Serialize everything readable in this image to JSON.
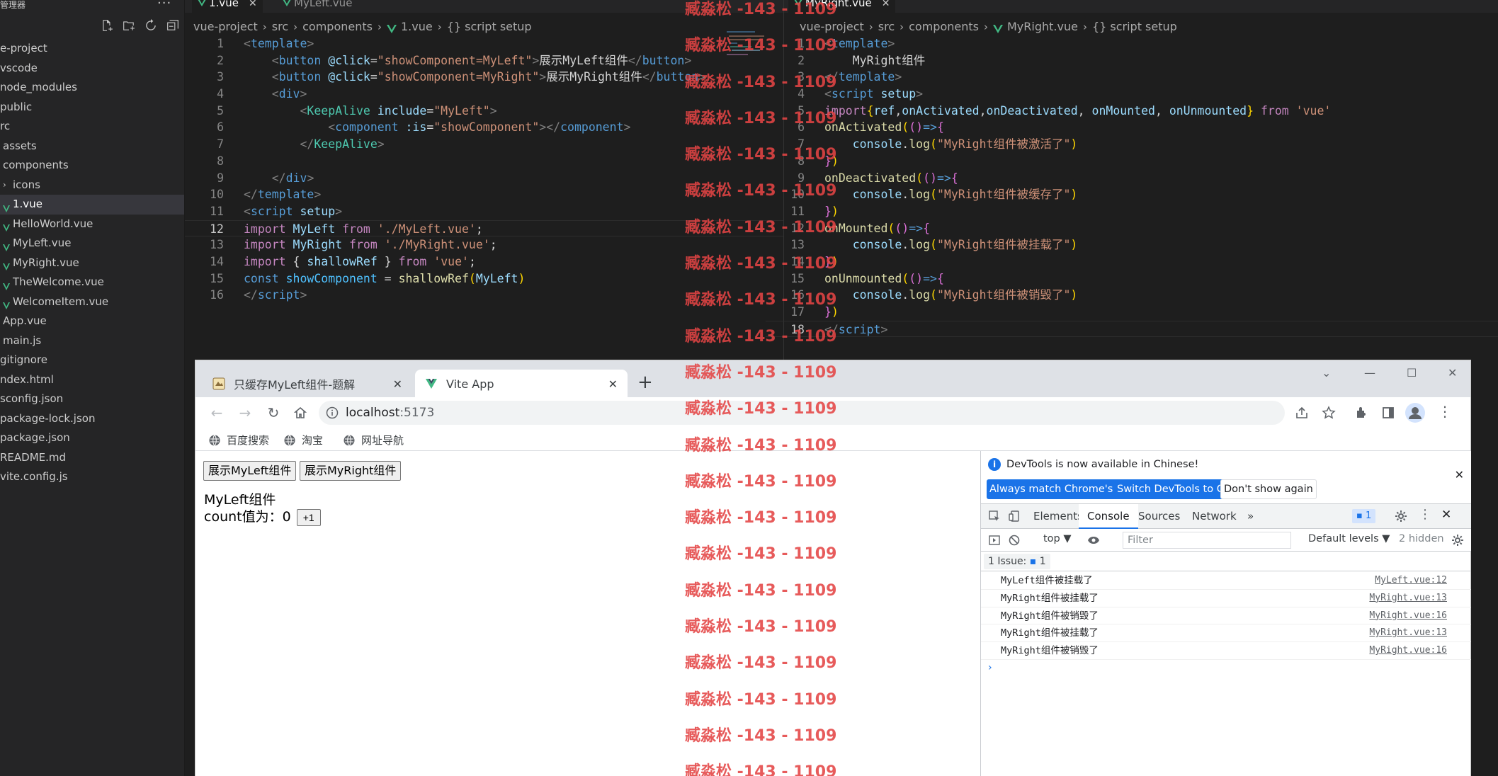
{
  "explorer": {
    "title": "管理器",
    "dots": "···",
    "actions": [
      "new-file",
      "new-folder",
      "refresh",
      "collapse-all"
    ],
    "tree": [
      {
        "label": "e-project",
        "indent": 0
      },
      {
        "label": "vscode",
        "indent": 0
      },
      {
        "label": "node_modules",
        "indent": 0
      },
      {
        "label": "public",
        "indent": 0
      },
      {
        "label": "rc",
        "indent": 0
      },
      {
        "label": "assets",
        "indent": 1
      },
      {
        "label": "components",
        "indent": 1
      },
      {
        "label": "icons",
        "indent": 1,
        "chevron": "›"
      },
      {
        "label": "1.vue",
        "indent": 1,
        "vue": true,
        "active": true
      },
      {
        "label": "HelloWorld.vue",
        "indent": 1,
        "vue": true
      },
      {
        "label": "MyLeft.vue",
        "indent": 1,
        "vue": true
      },
      {
        "label": "MyRight.vue",
        "indent": 1,
        "vue": true
      },
      {
        "label": "TheWelcome.vue",
        "indent": 1,
        "vue": true
      },
      {
        "label": "WelcomeItem.vue",
        "indent": 1,
        "vue": true
      },
      {
        "label": "App.vue",
        "indent": 1
      },
      {
        "label": "main.js",
        "indent": 1
      },
      {
        "label": "gitignore",
        "indent": 0
      },
      {
        "label": "ndex.html",
        "indent": 0
      },
      {
        "label": "sconfig.json",
        "indent": 0
      },
      {
        "label": "package-lock.json",
        "indent": 0
      },
      {
        "label": "package.json",
        "indent": 0
      },
      {
        "label": "README.md",
        "indent": 0
      },
      {
        "label": "vite.config.js",
        "indent": 0
      }
    ]
  },
  "left_editor": {
    "tabs": [
      {
        "label": "1.vue",
        "active": true,
        "close": "✕"
      },
      {
        "label": "MyLeft.vue",
        "active": false
      }
    ],
    "breadcrumb": [
      "vue-project",
      "src",
      "components",
      "1.vue",
      "{} script setup"
    ],
    "current_line": 12,
    "lines": [
      {
        "n": 1,
        "indent": 0,
        "tokens": [
          [
            "t-br",
            "<"
          ],
          [
            "t-tag",
            "template"
          ],
          [
            "t-br",
            ">"
          ]
        ]
      },
      {
        "n": 2,
        "indent": 4,
        "tokens": [
          [
            "t-br",
            "<"
          ],
          [
            "t-tag",
            "button"
          ],
          [
            "t-txt",
            " "
          ],
          [
            "t-attr",
            "@click"
          ],
          [
            "t-txt",
            "="
          ],
          [
            "t-str",
            "\"showComponent=MyLeft\""
          ],
          [
            "t-br",
            ">"
          ],
          [
            "t-txt",
            "展示MyLeft组件"
          ],
          [
            "t-br",
            "</"
          ],
          [
            "t-tag",
            "button"
          ],
          [
            "t-br",
            ">"
          ]
        ]
      },
      {
        "n": 3,
        "indent": 4,
        "tokens": [
          [
            "t-br",
            "<"
          ],
          [
            "t-tag",
            "button"
          ],
          [
            "t-txt",
            " "
          ],
          [
            "t-attr",
            "@click"
          ],
          [
            "t-txt",
            "="
          ],
          [
            "t-str",
            "\"showComponent=MyRight\""
          ],
          [
            "t-br",
            ">"
          ],
          [
            "t-txt",
            "展示MyRight组件"
          ],
          [
            "t-br",
            "</"
          ],
          [
            "t-tag",
            "button"
          ],
          [
            "t-br",
            ">"
          ]
        ]
      },
      {
        "n": 4,
        "indent": 4,
        "tokens": [
          [
            "t-br",
            "<"
          ],
          [
            "t-tag",
            "div"
          ],
          [
            "t-br",
            ">"
          ]
        ]
      },
      {
        "n": 5,
        "indent": 8,
        "tokens": [
          [
            "t-br",
            "<"
          ],
          [
            "t-cn",
            "KeepAlive"
          ],
          [
            "t-txt",
            " "
          ],
          [
            "t-attr",
            "include"
          ],
          [
            "t-txt",
            "="
          ],
          [
            "t-str",
            "\"MyLeft\""
          ],
          [
            "t-br",
            ">"
          ]
        ]
      },
      {
        "n": 6,
        "indent": 12,
        "tokens": [
          [
            "t-br",
            "<"
          ],
          [
            "t-tag",
            "component"
          ],
          [
            "t-txt",
            " "
          ],
          [
            "t-attr",
            ":is"
          ],
          [
            "t-txt",
            "="
          ],
          [
            "t-str",
            "\"showComponent\""
          ],
          [
            "t-br",
            "></"
          ],
          [
            "t-tag",
            "component"
          ],
          [
            "t-br",
            ">"
          ]
        ]
      },
      {
        "n": 7,
        "indent": 8,
        "tokens": [
          [
            "t-br",
            "</"
          ],
          [
            "t-cn",
            "KeepAlive"
          ],
          [
            "t-br",
            ">"
          ]
        ]
      },
      {
        "n": 8,
        "indent": 0,
        "tokens": []
      },
      {
        "n": 9,
        "indent": 4,
        "tokens": [
          [
            "t-br",
            "</"
          ],
          [
            "t-tag",
            "div"
          ],
          [
            "t-br",
            ">"
          ]
        ]
      },
      {
        "n": 10,
        "indent": 0,
        "tokens": [
          [
            "t-br",
            "</"
          ],
          [
            "t-tag",
            "template"
          ],
          [
            "t-br",
            ">"
          ]
        ]
      },
      {
        "n": 11,
        "indent": 0,
        "tokens": [
          [
            "t-br",
            "<"
          ],
          [
            "t-tag",
            "script"
          ],
          [
            "t-txt",
            " "
          ],
          [
            "t-attr",
            "setup"
          ],
          [
            "t-br",
            ">"
          ]
        ]
      },
      {
        "n": 12,
        "indent": 0,
        "tokens": [
          [
            "t-kw",
            "import"
          ],
          [
            "t-txt",
            " "
          ],
          [
            "t-var",
            "MyLeft"
          ],
          [
            "t-txt",
            " "
          ],
          [
            "t-kw",
            "from"
          ],
          [
            "t-txt",
            " "
          ],
          [
            "t-str",
            "'./MyLeft.vue'"
          ],
          [
            "t-txt",
            ";"
          ]
        ]
      },
      {
        "n": 13,
        "indent": 0,
        "tokens": [
          [
            "t-kw",
            "import"
          ],
          [
            "t-txt",
            " "
          ],
          [
            "t-var",
            "MyRight"
          ],
          [
            "t-txt",
            " "
          ],
          [
            "t-kw",
            "from"
          ],
          [
            "t-txt",
            " "
          ],
          [
            "t-str",
            "'./MyRight.vue'"
          ],
          [
            "t-txt",
            ";"
          ]
        ]
      },
      {
        "n": 14,
        "indent": 0,
        "tokens": [
          [
            "t-kw",
            "import"
          ],
          [
            "t-txt",
            " { "
          ],
          [
            "t-var",
            "shallowRef"
          ],
          [
            "t-txt",
            " } "
          ],
          [
            "t-kw",
            "from"
          ],
          [
            "t-txt",
            " "
          ],
          [
            "t-str",
            "'vue'"
          ],
          [
            "t-txt",
            ";"
          ]
        ]
      },
      {
        "n": 15,
        "indent": 0,
        "tokens": [
          [
            "t-dk",
            "const"
          ],
          [
            "t-txt",
            " "
          ],
          [
            "t-const",
            "showComponent"
          ],
          [
            "t-txt",
            " = "
          ],
          [
            "t-fn",
            "shallowRef"
          ],
          [
            "t-paren",
            "("
          ],
          [
            "t-var",
            "MyLeft"
          ],
          [
            "t-paren",
            ")"
          ]
        ]
      },
      {
        "n": 16,
        "indent": 0,
        "tokens": [
          [
            "t-br",
            "</"
          ],
          [
            "t-tag",
            "script"
          ],
          [
            "t-br",
            ">"
          ]
        ]
      }
    ]
  },
  "right_editor": {
    "tabs": [
      {
        "label": "MyRight.vue",
        "active": true,
        "close": "✕"
      }
    ],
    "breadcrumb": [
      "vue-project",
      "src",
      "components",
      "MyRight.vue",
      "{} script setup"
    ],
    "current_line": 18,
    "lines": [
      {
        "n": 1,
        "indent": 0,
        "tokens": [
          [
            "t-br",
            "<"
          ],
          [
            "t-tag",
            "template"
          ],
          [
            "t-br",
            ">"
          ]
        ]
      },
      {
        "n": 2,
        "indent": 4,
        "tokens": [
          [
            "t-txt",
            "MyRight组件"
          ]
        ]
      },
      {
        "n": 3,
        "indent": 0,
        "tokens": [
          [
            "t-br",
            "</"
          ],
          [
            "t-tag",
            "template"
          ],
          [
            "t-br",
            ">"
          ]
        ]
      },
      {
        "n": 4,
        "indent": 0,
        "tokens": [
          [
            "t-br",
            "<"
          ],
          [
            "t-tag",
            "script"
          ],
          [
            "t-txt",
            " "
          ],
          [
            "t-attr",
            "setup"
          ],
          [
            "t-br",
            ">"
          ]
        ]
      },
      {
        "n": 5,
        "indent": 0,
        "tokens": [
          [
            "t-kw",
            "import"
          ],
          [
            "t-paren",
            "{"
          ],
          [
            "t-var",
            "ref"
          ],
          [
            "t-txt",
            ","
          ],
          [
            "t-var",
            "onActivated"
          ],
          [
            "t-txt",
            ","
          ],
          [
            "t-var",
            "onDeactivated"
          ],
          [
            "t-txt",
            ", "
          ],
          [
            "t-var",
            "onMounted"
          ],
          [
            "t-txt",
            ", "
          ],
          [
            "t-var",
            "onUnmounted"
          ],
          [
            "t-paren",
            "}"
          ],
          [
            "t-txt",
            " "
          ],
          [
            "t-kw",
            "from"
          ],
          [
            "t-txt",
            " "
          ],
          [
            "t-str",
            "'vue'"
          ]
        ]
      },
      {
        "n": 6,
        "indent": 0,
        "tokens": [
          [
            "t-fn",
            "onActivated"
          ],
          [
            "t-paren",
            "("
          ],
          [
            "t-brace",
            "()"
          ],
          [
            "t-dk",
            "=>"
          ],
          [
            "t-brace",
            "{"
          ]
        ]
      },
      {
        "n": 7,
        "indent": 4,
        "tokens": [
          [
            "t-var",
            "console"
          ],
          [
            "t-txt",
            "."
          ],
          [
            "t-fn",
            "log"
          ],
          [
            "t-paren",
            "("
          ],
          [
            "t-str",
            "\"MyRight组件被激活了\""
          ],
          [
            "t-paren",
            ")"
          ]
        ]
      },
      {
        "n": 8,
        "indent": 0,
        "tokens": [
          [
            "t-brace",
            "}"
          ],
          [
            "t-paren",
            ")"
          ]
        ]
      },
      {
        "n": 9,
        "indent": 0,
        "tokens": [
          [
            "t-fn",
            "onDeactivated"
          ],
          [
            "t-paren",
            "("
          ],
          [
            "t-brace",
            "()"
          ],
          [
            "t-dk",
            "=>"
          ],
          [
            "t-brace",
            "{"
          ]
        ]
      },
      {
        "n": 10,
        "indent": 4,
        "tokens": [
          [
            "t-var",
            "console"
          ],
          [
            "t-txt",
            "."
          ],
          [
            "t-fn",
            "log"
          ],
          [
            "t-paren",
            "("
          ],
          [
            "t-str",
            "\"MyRight组件被缓存了\""
          ],
          [
            "t-paren",
            ")"
          ]
        ]
      },
      {
        "n": 11,
        "indent": 0,
        "tokens": [
          [
            "t-brace",
            "}"
          ],
          [
            "t-paren",
            ")"
          ]
        ]
      },
      {
        "n": 12,
        "indent": 0,
        "tokens": [
          [
            "t-fn",
            "onMounted"
          ],
          [
            "t-paren",
            "("
          ],
          [
            "t-brace",
            "()"
          ],
          [
            "t-dk",
            "=>"
          ],
          [
            "t-brace",
            "{"
          ]
        ]
      },
      {
        "n": 13,
        "indent": 4,
        "tokens": [
          [
            "t-var",
            "console"
          ],
          [
            "t-txt",
            "."
          ],
          [
            "t-fn",
            "log"
          ],
          [
            "t-paren",
            "("
          ],
          [
            "t-str",
            "\"MyRight组件被挂载了\""
          ],
          [
            "t-paren",
            ")"
          ]
        ]
      },
      {
        "n": 14,
        "indent": 0,
        "tokens": [
          [
            "t-brace",
            "}"
          ],
          [
            "t-paren",
            ")"
          ]
        ]
      },
      {
        "n": 15,
        "indent": 0,
        "tokens": [
          [
            "t-fn",
            "onUnmounted"
          ],
          [
            "t-paren",
            "("
          ],
          [
            "t-brace",
            "()"
          ],
          [
            "t-dk",
            "=>"
          ],
          [
            "t-brace",
            "{"
          ]
        ]
      },
      {
        "n": 16,
        "indent": 4,
        "tokens": [
          [
            "t-var",
            "console"
          ],
          [
            "t-txt",
            "."
          ],
          [
            "t-fn",
            "log"
          ],
          [
            "t-paren",
            "("
          ],
          [
            "t-str",
            "\"MyRight组件被销毁了\""
          ],
          [
            "t-paren",
            ")"
          ]
        ]
      },
      {
        "n": 17,
        "indent": 0,
        "tokens": [
          [
            "t-brace",
            "}"
          ],
          [
            "t-paren",
            ")"
          ]
        ]
      },
      {
        "n": 18,
        "indent": 0,
        "tokens": [
          [
            "t-br",
            "</"
          ],
          [
            "t-tag",
            "script"
          ],
          [
            "t-br",
            ">"
          ]
        ]
      }
    ]
  },
  "watermark": {
    "text": "臧淼松 -143 - 1109",
    "count": 22
  },
  "chrome": {
    "tabs": [
      {
        "title": "只缓存MyLeft组件-题解",
        "active": false,
        "icon": "puzzle-favicon"
      },
      {
        "title": "Vite App",
        "active": true,
        "icon": "vue-favicon"
      }
    ],
    "new_tab": "+",
    "window_controls": [
      "⌄",
      "—",
      "☐",
      "✕"
    ],
    "url_host": "localhost",
    "url_port": ":5173",
    "bookmarks": [
      "百度搜索",
      "淘宝",
      "网址导航"
    ]
  },
  "page": {
    "btn_left": "展示MyLeft组件",
    "btn_right": "展示MyRight组件",
    "component_title": "MyLeft组件",
    "count_label": "count值为：",
    "count_value": "0",
    "inc_button": "+1"
  },
  "devtools": {
    "info_message": "DevTools is now available in Chinese!",
    "btn_match": "Always match Chrome's language",
    "btn_switch": "Switch DevTools to Chinese",
    "btn_dismiss": "Don't show again",
    "tabs": [
      "Elements",
      "Console",
      "Sources",
      "Network",
      "»"
    ],
    "active_tab": "Console",
    "issues_badge": "1",
    "context": "top ▼",
    "filter_placeholder": "Filter",
    "levels": "Default levels ▼",
    "hidden": "2 hidden",
    "issue_label": "1 Issue:",
    "issue_count": "1",
    "logs": [
      {
        "msg": "MyLeft组件被挂载了",
        "src": "MyLeft.vue:12"
      },
      {
        "msg": "MyRight组件被挂载了",
        "src": "MyRight.vue:13"
      },
      {
        "msg": "MyRight组件被销毁了",
        "src": "MyRight.vue:16"
      },
      {
        "msg": "MyRight组件被挂载了",
        "src": "MyRight.vue:13"
      },
      {
        "msg": "MyRight组件被销毁了",
        "src": "MyRight.vue:16"
      }
    ],
    "prompt": "›"
  },
  "colors": {
    "vscode_bg": "#1e1e1e",
    "sidebar_bg": "#252526",
    "vue_green": "#41b883",
    "chrome_accent": "#1a73e8",
    "watermark": "#e44444"
  }
}
